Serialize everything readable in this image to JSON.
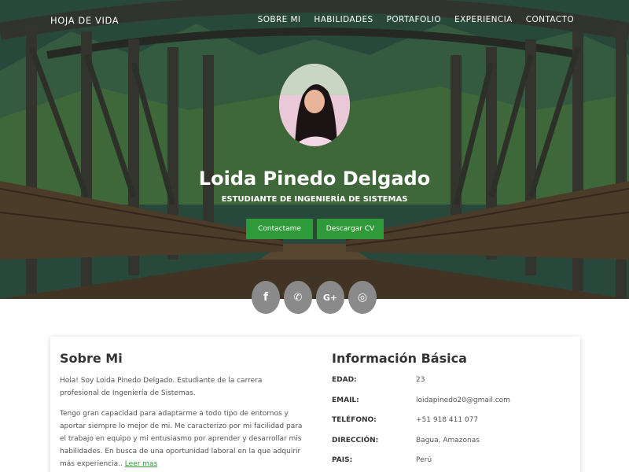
{
  "brand": "HOJA DE VIDA",
  "nav": [
    "SOBRE MI",
    "HABILIDADES",
    "PORTAFOLIO",
    "EXPERIENCIA",
    "CONTACTO"
  ],
  "hero": {
    "name": "Loida Pinedo Delgado",
    "subtitle": "ESTUDIANTE DE INGENIERÍA DE SISTEMAS",
    "buttons": {
      "contact": "Contactame",
      "cv": "Descargar CV"
    }
  },
  "social": [
    {
      "icon": "facebook-icon",
      "glyph": "f"
    },
    {
      "icon": "whatsapp-icon",
      "glyph": "✆"
    },
    {
      "icon": "google-plus-icon",
      "glyph": "G+"
    },
    {
      "icon": "instagram-icon",
      "glyph": "◎"
    }
  ],
  "about": {
    "title": "Sobre Mi",
    "p1": "Hola! Soy Loida Pinedo Delgado. Estudiante de la carrera profesional de Ingeniería de Sistemas.",
    "p2": "Tengo gran capacidad para adaptarme a todo tipo de entornos y aportar siempre lo mejor de mi. Me caracterizo por mi facilidad para el trabajo en equipo y mi entusiasmo por aprender y desarrollar mis habilidades. En busca de una oportunidad laboral en la que adquirir más experiencia..",
    "more": "Leer mas"
  },
  "info": {
    "title": "Información Básica",
    "rows": [
      {
        "label": "EDAD:",
        "value": "23"
      },
      {
        "label": "EMAIL:",
        "value": "loidapinedo20@gmail.com"
      },
      {
        "label": "TELÉFONO:",
        "value": "+51 918 411 077"
      },
      {
        "label": "DIRECCIÓN:",
        "value": "Bagua, Amazonas"
      },
      {
        "label": "PAIS:",
        "value": "Perú"
      }
    ]
  },
  "colors": {
    "accent": "#2e9a3a",
    "social": "#8a8a8a"
  }
}
